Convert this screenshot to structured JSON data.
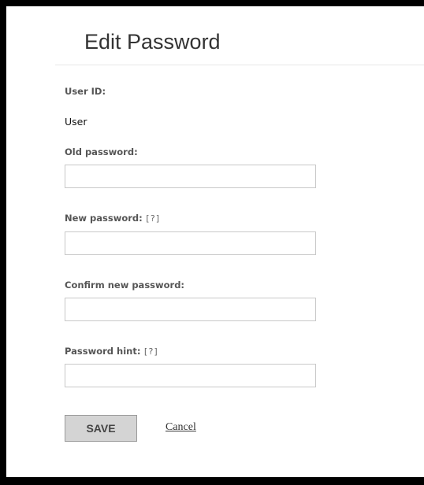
{
  "page": {
    "title": "Edit Password"
  },
  "form": {
    "user_id_label": "User ID:",
    "user_id_value": "User",
    "old_password_label": "Old password:",
    "old_password_value": "",
    "new_password_label": "New password:",
    "new_password_help": "[?]",
    "new_password_value": "",
    "confirm_password_label": "Confirm new password:",
    "confirm_password_value": "",
    "hint_label": "Password hint:",
    "hint_help": "[?]",
    "hint_value": ""
  },
  "actions": {
    "save_label": "SAVE",
    "cancel_label": "Cancel"
  }
}
